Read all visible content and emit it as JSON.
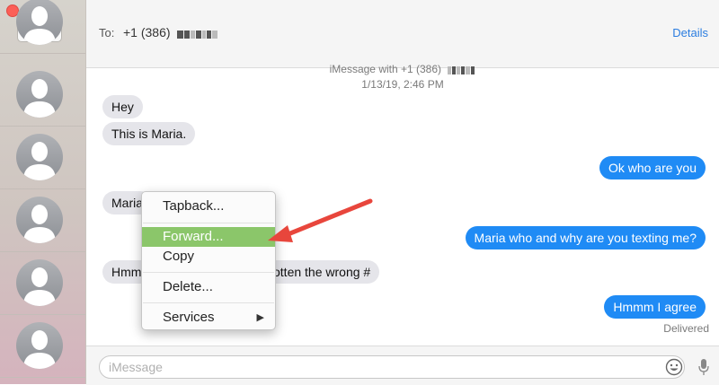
{
  "window": {
    "compose_icon": "compose-icon"
  },
  "header": {
    "to_label": "To:",
    "recipient": "+1 (386)",
    "details_label": "Details"
  },
  "conversation": {
    "service_info": "iMessage with +1 (386)",
    "timestamp": "1/13/19, 2:46 PM",
    "messages": [
      {
        "side": "incoming",
        "text": "Hey"
      },
      {
        "side": "incoming",
        "text": "This is Maria."
      },
      {
        "side": "outgoing",
        "text": "Ok who are you"
      },
      {
        "side": "incoming",
        "text": "Maria"
      },
      {
        "side": "outgoing",
        "text": "Maria who and why are you texting me?"
      },
      {
        "side": "incoming_start",
        "text": "Hmm"
      },
      {
        "side": "incoming_end",
        "text": "otten the wrong #"
      },
      {
        "side": "outgoing",
        "text": "Hmmm I agree"
      }
    ],
    "delivered_label": "Delivered"
  },
  "context_menu": {
    "items": [
      {
        "label": "Tapback..."
      },
      {
        "label": "Forward...",
        "highlighted": true
      },
      {
        "label": "Copy"
      },
      {
        "label": "Delete..."
      },
      {
        "label": "Services",
        "submenu_icon": "submenu-arrow-icon"
      }
    ]
  },
  "input_bar": {
    "placeholder": "iMessage",
    "emoji_icon": "emoji-icon",
    "mic_icon": "microphone-icon"
  },
  "colors": {
    "outgoing_bubble": "#1f8bf5",
    "incoming_bubble": "#e5e5ea",
    "menu_highlight": "#8bc66a",
    "annotation_arrow": "#e8463c",
    "link": "#2b7de0"
  }
}
